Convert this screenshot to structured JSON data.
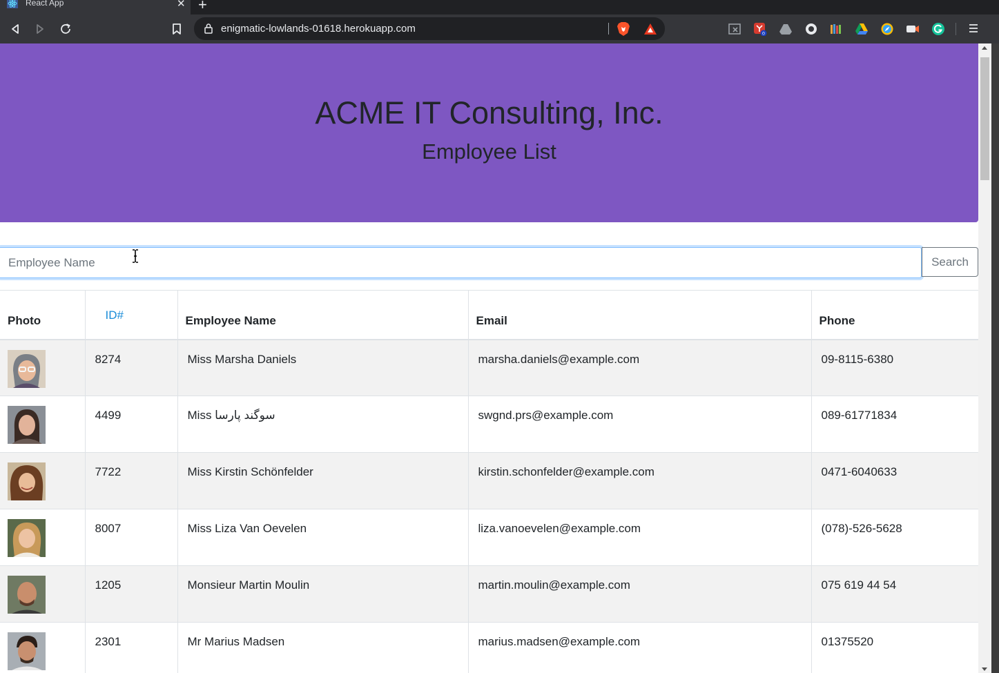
{
  "browser": {
    "tab_title": "React App",
    "url": "enigmatic-lowlands-01618.herokuapp.com",
    "rewards_badge": "0"
  },
  "header": {
    "title": "ACME IT Consulting, Inc.",
    "subtitle": "Employee List",
    "color": "#7e57c2"
  },
  "search": {
    "placeholder": "Employee Name",
    "value": "",
    "button_label": "Search"
  },
  "table": {
    "columns": [
      "Photo",
      "ID#",
      "Employee Name",
      "Email",
      "Phone"
    ],
    "rows": [
      {
        "id": "8274",
        "name": "Miss Marsha Daniels",
        "email": "marsha.daniels@example.com",
        "phone": "09-8115-6380"
      },
      {
        "id": "4499",
        "name": "Miss سوگند پارسا",
        "email": "swgnd.prs@example.com",
        "phone": "089-61771834"
      },
      {
        "id": "7722",
        "name": "Miss Kirstin Schönfelder",
        "email": "kirstin.schonfelder@example.com",
        "phone": "0471-6040633"
      },
      {
        "id": "8007",
        "name": "Miss Liza Van Oevelen",
        "email": "liza.vanoevelen@example.com",
        "phone": "(078)-526-5628"
      },
      {
        "id": "1205",
        "name": "Monsieur Martin Moulin",
        "email": "martin.moulin@example.com",
        "phone": "075 619 44 54"
      },
      {
        "id": "2301",
        "name": "Mr Marius Madsen",
        "email": "marius.madsen@example.com",
        "phone": "01375520"
      }
    ]
  }
}
